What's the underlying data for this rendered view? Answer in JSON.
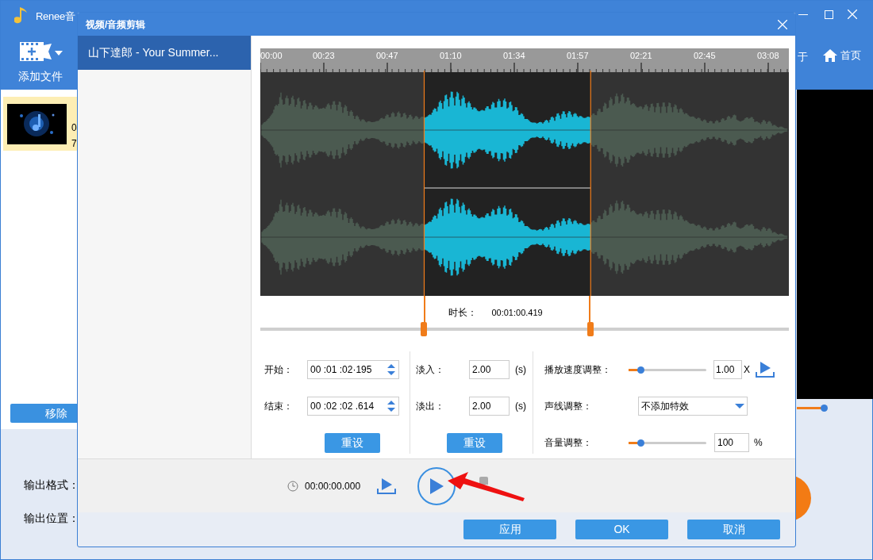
{
  "app": {
    "title": "Renee音",
    "add_file": "添加文件",
    "toolbar_items": [
      {
        "label": "于"
      },
      {
        "label": "首页"
      }
    ],
    "file_item": {
      "selected": true,
      "lines": [
        "0",
        "7"
      ]
    },
    "remove_button": "移除",
    "output_format": "输出格式：",
    "output_location": "输出位置："
  },
  "dialog": {
    "title": "视频/音频剪辑",
    "files": [
      {
        "name": "山下達郎 - Your Summer...",
        "selected": true
      }
    ],
    "ruler": [
      "00:00",
      "00:23",
      "00:47",
      "01:10",
      "01:34",
      "01:57",
      "02:21",
      "02:45",
      "03:08"
    ],
    "selection": {
      "start": {
        "level": 0.31
      },
      "end": {
        "level": 0.625
      }
    },
    "duration": {
      "label": "时长：",
      "value": "00:01:00.419"
    },
    "start": {
      "label": "开始：",
      "value": "00 :01 :02·195"
    },
    "end": {
      "label": "结束：",
      "value": "00 :02 :02 .614"
    },
    "reset_time": "重设",
    "fade_in": {
      "label": "淡入：",
      "value": "2.00",
      "unit": "(s)"
    },
    "fade_out": {
      "label": "淡出：",
      "value": "2.00",
      "unit": "(s)"
    },
    "reset_fade": "重设",
    "speed": {
      "label": "播放速度调整：",
      "level": 0.15,
      "value": "1.00",
      "unit": "X"
    },
    "voice": {
      "label": "声线调整：",
      "value": "不添加特效"
    },
    "volume": {
      "label": "音量调整：",
      "level": 0.15,
      "value": "100",
      "unit": "%"
    },
    "playback_time": "00:00:00.000",
    "buttons": [
      "应用",
      "OK",
      "取消"
    ]
  }
}
